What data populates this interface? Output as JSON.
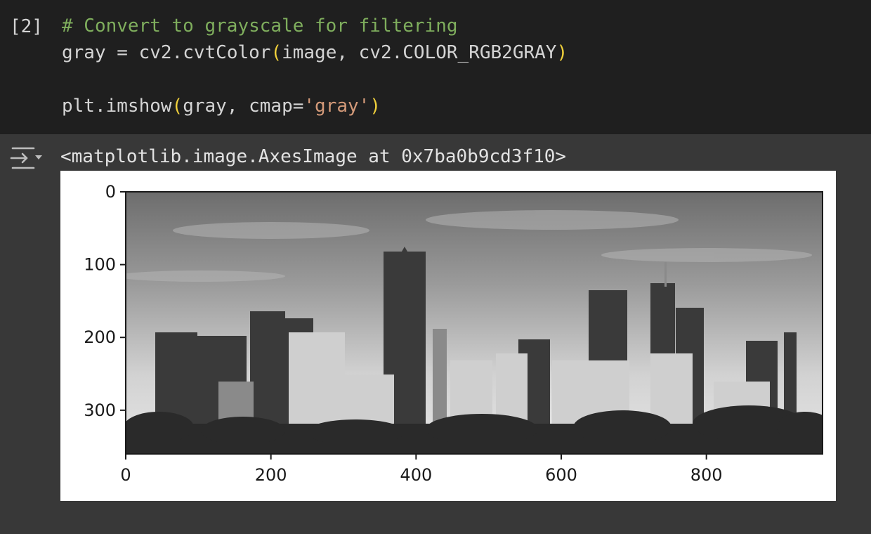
{
  "code_cell": {
    "execution_count": "[2]",
    "lines": [
      {
        "comment": "# Convert to grayscale for filtering"
      },
      {
        "var": "gray",
        "eq": " = ",
        "fn": "cv2.cvtColor",
        "open": "(",
        "args": "image, cv2.COLOR_RGB2GRAY",
        "close": ")"
      },
      {
        "blank": ""
      },
      {
        "fn": "plt.imshow",
        "open": "(",
        "args_pre": "gray, cmap=",
        "string": "'gray'",
        "close": ")"
      }
    ]
  },
  "output": {
    "toggle_icon": "output-toggle-icon",
    "repr": "<matplotlib.image.AxesImage at 0x7ba0b9cd3f10>",
    "figure": {
      "image_description": "grayscale city skyline",
      "y_ticks": [
        "0",
        "100",
        "200",
        "300"
      ],
      "x_ticks": [
        "0",
        "200",
        "400",
        "600",
        "800"
      ],
      "y_tick_values": [
        0,
        100,
        200,
        300
      ],
      "x_tick_values": [
        0,
        200,
        400,
        600,
        800
      ],
      "x_extent": [
        0,
        960
      ],
      "y_extent": [
        0,
        360
      ],
      "cmap": "gray"
    }
  },
  "colors": {
    "code_bg": "#1f1f1f",
    "output_bg": "#383838",
    "comment": "#7fae5d",
    "paren": "#f0d03b",
    "string": "#d49a79"
  }
}
